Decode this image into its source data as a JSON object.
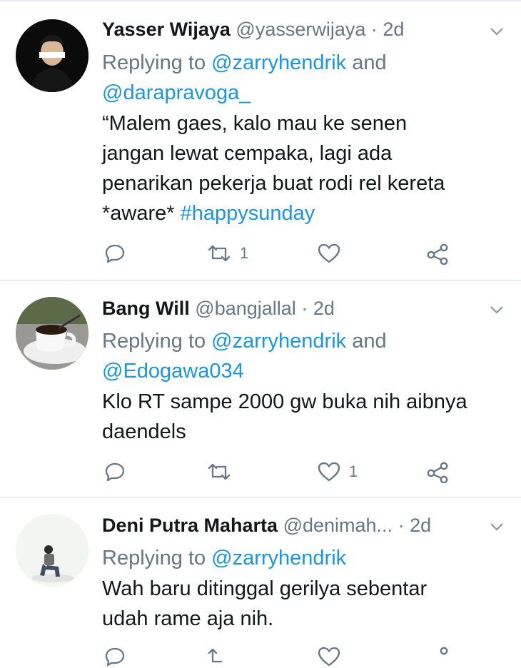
{
  "tweets": [
    {
      "name": "Yasser Wijaya",
      "handle": "@yasserwijaya",
      "time": "2d",
      "replying_prefix": "Replying to ",
      "reply_line1_mention": "@zarryhendrik",
      "reply_line1_suffix": " and",
      "reply_line2_mention": "@darapravoga_",
      "text_lines": [
        "“Malem gaes, kalo mau ke senen",
        "jangan lewat cempaka, lagi ada",
        "penarikan pekerja buat rodi rel kereta"
      ],
      "text_last_plain": "*aware* ",
      "hashtag": "#happysunday",
      "retweets": "1",
      "likes": "",
      "avatar_icon": "person-avatar-dark"
    },
    {
      "name": "Bang Will",
      "handle": "@bangjallal",
      "time": "2d",
      "replying_prefix": "Replying to ",
      "reply_line1_mention": "@zarryhendrik",
      "reply_line1_suffix": " and",
      "reply_line2_mention": "@Edogawa034",
      "text_lines": [
        "Klo RT sampe 2000 gw buka nih aibnya",
        "daendels"
      ],
      "retweets": "",
      "likes": "1",
      "avatar_icon": "coffee-cup-avatar"
    },
    {
      "name": "Deni Putra Maharta",
      "handle": "@denimah...",
      "time": "2d",
      "replying_prefix": "Replying to ",
      "reply_line1_mention": "@zarryhendrik",
      "text_lines": [
        "Wah baru ditinggal gerilya sebentar",
        "udah rame aja nih."
      ],
      "avatar_icon": "person-sitting-avatar"
    }
  ],
  "separator": "·",
  "colors": {
    "link": "#1b95e0",
    "muted": "#657786",
    "text": "#14171a",
    "border": "#e6ecf0"
  }
}
